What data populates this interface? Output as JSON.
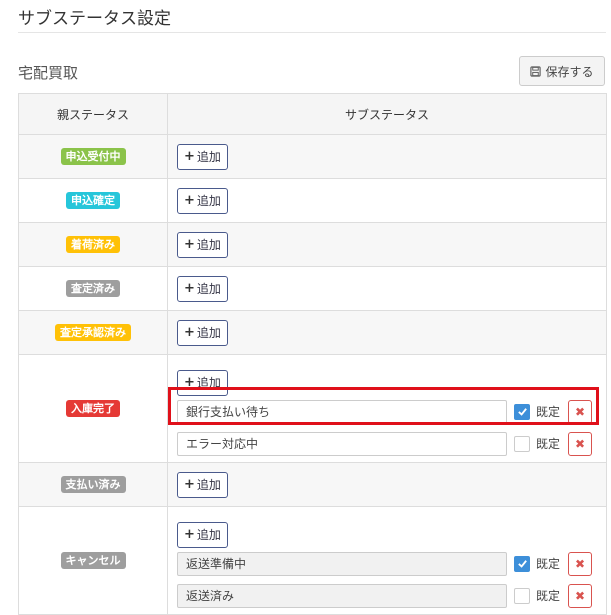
{
  "page": {
    "title": "サブステータス設定"
  },
  "section": {
    "title": "宅配買取",
    "save_label": "保存する"
  },
  "table": {
    "headers": {
      "parent": "親ステータス",
      "sub": "サブステータス"
    },
    "add_label": "追加",
    "default_label": "既定",
    "delete_glyph": "✖",
    "rows": [
      {
        "status": "申込受付中",
        "color": "#8bc34a",
        "subs": []
      },
      {
        "status": "申込確定",
        "color": "#26c6da",
        "subs": []
      },
      {
        "status": "着荷済み",
        "color": "#ffc107",
        "subs": []
      },
      {
        "status": "査定済み",
        "color": "#9e9e9e",
        "subs": []
      },
      {
        "status": "査定承認済み",
        "color": "#ffc107",
        "subs": []
      },
      {
        "status": "入庫完了",
        "color": "#e53935",
        "subs": [
          {
            "name": "銀行支払い待ち",
            "default": true
          },
          {
            "name": "エラー対応中",
            "default": false
          }
        ]
      },
      {
        "status": "支払い済み",
        "color": "#9e9e9e",
        "subs": []
      },
      {
        "status": "キャンセル",
        "color": "#9e9e9e",
        "subs": [
          {
            "name": "返送準備中",
            "default": true
          },
          {
            "name": "返送済み",
            "default": false
          }
        ]
      }
    ]
  },
  "colors": {
    "highlight": "#e0101a",
    "checkbox_checked": "#3d8fd9",
    "delete": "#d9534f"
  }
}
